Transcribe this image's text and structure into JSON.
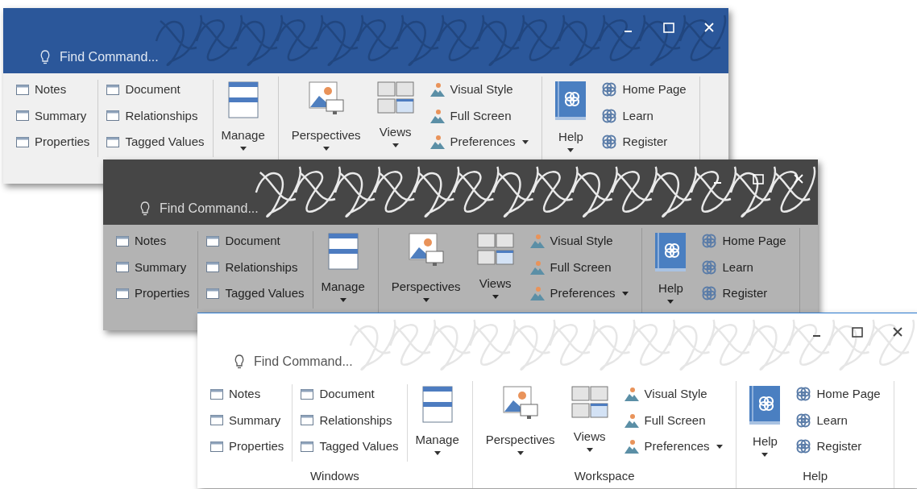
{
  "windows": [
    {
      "kind": "blue",
      "search": {
        "placeholder": "Find Command..."
      },
      "groups": [
        {
          "columns": [
            {
              "items": [
                {
                  "kind": "window",
                  "label": "Notes",
                  "dropdown": false
                },
                {
                  "kind": "window",
                  "label": "Summary",
                  "dropdown": false
                },
                {
                  "kind": "window",
                  "label": "Properties",
                  "dropdown": false
                }
              ]
            },
            {
              "divider": true,
              "items": [
                {
                  "kind": "window",
                  "label": "Document",
                  "dropdown": false
                },
                {
                  "kind": "window",
                  "label": "Relationships",
                  "dropdown": false
                },
                {
                  "kind": "window",
                  "label": "Tagged Values",
                  "dropdown": false
                }
              ]
            },
            {
              "divider": true,
              "items": [
                {
                  "kind": "manage",
                  "label": "Manage",
                  "dropdown": true
                }
              ]
            }
          ]
        },
        {
          "columns": [
            {
              "items": [
                {
                  "kind": "perspectives",
                  "label": "Perspectives",
                  "dropdown": true
                }
              ]
            },
            {
              "items": [
                {
                  "kind": "views",
                  "label": "Views",
                  "dropdown": true
                }
              ]
            },
            {
              "items": [
                {
                  "kind": "style",
                  "label": "Visual Style",
                  "dropdown": false
                },
                {
                  "kind": "style",
                  "label": "Full Screen",
                  "dropdown": false
                },
                {
                  "kind": "style",
                  "label": "Preferences",
                  "dropdown": true
                }
              ]
            }
          ]
        },
        {
          "columns": [
            {
              "items": [
                {
                  "kind": "help",
                  "label": "Help",
                  "dropdown": true
                }
              ]
            },
            {
              "items": [
                {
                  "kind": "link",
                  "label": "Home Page",
                  "dropdown": false
                },
                {
                  "kind": "link",
                  "label": "Learn",
                  "dropdown": false
                },
                {
                  "kind": "link",
                  "label": "Register",
                  "dropdown": false
                }
              ]
            }
          ]
        }
      ]
    },
    {
      "kind": "dark",
      "search": {
        "placeholder": "Find Command..."
      },
      "groups": [
        {
          "columns": [
            {
              "items": [
                {
                  "kind": "window",
                  "label": "Notes",
                  "dropdown": false
                },
                {
                  "kind": "window",
                  "label": "Summary",
                  "dropdown": false
                },
                {
                  "kind": "window",
                  "label": "Properties",
                  "dropdown": false
                }
              ]
            },
            {
              "divider": true,
              "items": [
                {
                  "kind": "window",
                  "label": "Document",
                  "dropdown": false
                },
                {
                  "kind": "window",
                  "label": "Relationships",
                  "dropdown": false
                },
                {
                  "kind": "window",
                  "label": "Tagged Values",
                  "dropdown": false
                }
              ]
            },
            {
              "divider": true,
              "items": [
                {
                  "kind": "manage",
                  "label": "Manage",
                  "dropdown": true
                }
              ]
            }
          ]
        },
        {
          "columns": [
            {
              "items": [
                {
                  "kind": "perspectives",
                  "label": "Perspectives",
                  "dropdown": true
                }
              ]
            },
            {
              "items": [
                {
                  "kind": "views",
                  "label": "Views",
                  "dropdown": true
                }
              ]
            },
            {
              "items": [
                {
                  "kind": "style",
                  "label": "Visual Style",
                  "dropdown": false
                },
                {
                  "kind": "style",
                  "label": "Full Screen",
                  "dropdown": false
                },
                {
                  "kind": "style",
                  "label": "Preferences",
                  "dropdown": true
                }
              ]
            }
          ]
        },
        {
          "columns": [
            {
              "items": [
                {
                  "kind": "help",
                  "label": "Help",
                  "dropdown": true
                }
              ]
            },
            {
              "items": [
                {
                  "kind": "link",
                  "label": "Home Page",
                  "dropdown": false
                },
                {
                  "kind": "link",
                  "label": "Learn",
                  "dropdown": false
                },
                {
                  "kind": "link",
                  "label": "Register",
                  "dropdown": false
                }
              ]
            }
          ]
        }
      ]
    },
    {
      "kind": "light",
      "search": {
        "placeholder": "Find Command..."
      },
      "groups": [
        {
          "label": "Windows",
          "columns": [
            {
              "items": [
                {
                  "kind": "window",
                  "label": "Notes",
                  "dropdown": false
                },
                {
                  "kind": "window",
                  "label": "Summary",
                  "dropdown": false
                },
                {
                  "kind": "window",
                  "label": "Properties",
                  "dropdown": false
                }
              ]
            },
            {
              "divider": true,
              "items": [
                {
                  "kind": "window",
                  "label": "Document",
                  "dropdown": false
                },
                {
                  "kind": "window",
                  "label": "Relationships",
                  "dropdown": false
                },
                {
                  "kind": "window",
                  "label": "Tagged Values",
                  "dropdown": false
                }
              ]
            },
            {
              "divider": true,
              "items": [
                {
                  "kind": "manage",
                  "label": "Manage",
                  "dropdown": true
                }
              ]
            }
          ]
        },
        {
          "label": "Workspace",
          "columns": [
            {
              "items": [
                {
                  "kind": "perspectives",
                  "label": "Perspectives",
                  "dropdown": true
                }
              ]
            },
            {
              "items": [
                {
                  "kind": "views",
                  "label": "Views",
                  "dropdown": true
                }
              ]
            },
            {
              "items": [
                {
                  "kind": "style",
                  "label": "Visual Style",
                  "dropdown": false
                },
                {
                  "kind": "style",
                  "label": "Full Screen",
                  "dropdown": false
                },
                {
                  "kind": "style",
                  "label": "Preferences",
                  "dropdown": true
                }
              ]
            }
          ]
        },
        {
          "label": "Help",
          "columns": [
            {
              "items": [
                {
                  "kind": "help",
                  "label": "Help",
                  "dropdown": true
                }
              ]
            },
            {
              "items": [
                {
                  "kind": "link",
                  "label": "Home Page",
                  "dropdown": false
                },
                {
                  "kind": "link",
                  "label": "Learn",
                  "dropdown": false
                },
                {
                  "kind": "link",
                  "label": "Register",
                  "dropdown": false
                }
              ]
            }
          ]
        }
      ]
    }
  ]
}
